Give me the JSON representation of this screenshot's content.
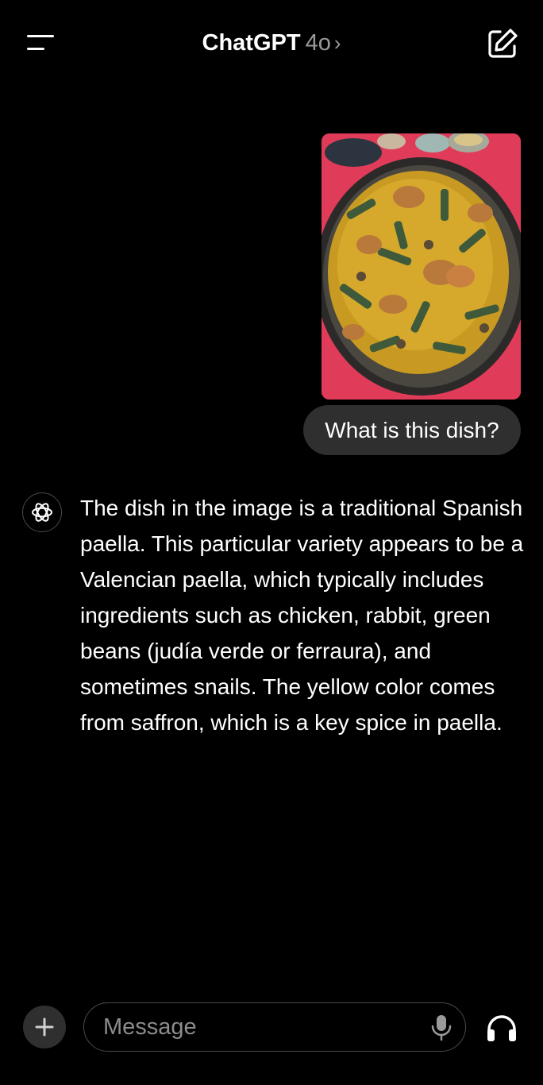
{
  "header": {
    "app_name": "ChatGPT",
    "model": "4o",
    "model_chevron": "›",
    "icons": {
      "menu": "menu-icon",
      "compose": "compose-icon"
    }
  },
  "conversation": {
    "user_message": {
      "image": {
        "icon": "paella-photo"
      },
      "text": "What is this dish?"
    },
    "assistant_message": {
      "avatar": "openai-logo-icon",
      "text": "The dish in the image is a traditional Spanish paella. This particular variety appears to be a Valencian paella, which typically includes ingredients such as chicken, rabbit, green beans (judía verde or ferraura), and sometimes snails. The yellow color comes from saffron, which is a key spice in paella."
    }
  },
  "composer": {
    "placeholder": "Message",
    "value": "",
    "icons": {
      "attach": "plus-icon",
      "mic": "microphone-icon",
      "voice": "headphones-icon"
    }
  },
  "colors": {
    "background": "#000000",
    "bubble": "#2f2f2f",
    "muted_text": "#9a9a9a",
    "border": "#4a4a4a"
  }
}
